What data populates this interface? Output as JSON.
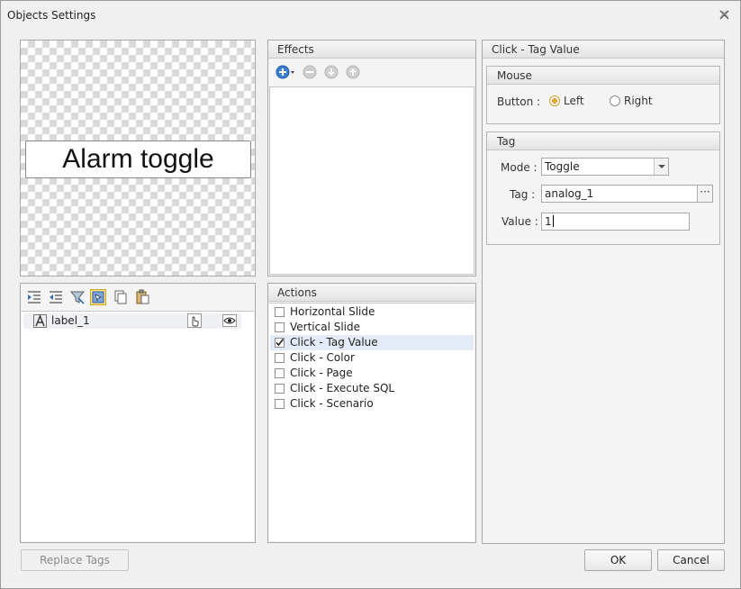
{
  "window": {
    "title": "Objects Settings"
  },
  "preview": {
    "label_text": "Alarm toggle"
  },
  "layers": {
    "toolbar_icons": [
      "indent-icon",
      "outdent-icon",
      "filter-icon",
      "select-icon",
      "copy-icon",
      "paste-icon"
    ],
    "items": [
      {
        "name": "label_1"
      }
    ]
  },
  "effects": {
    "header": "Effects",
    "toolbar_icons": [
      "add-icon",
      "remove-icon",
      "move-down-icon",
      "move-up-icon"
    ]
  },
  "actions": {
    "header": "Actions",
    "items": [
      {
        "label": "Horizontal Slide",
        "checked": false
      },
      {
        "label": "Vertical Slide",
        "checked": false
      },
      {
        "label": "Click - Tag Value",
        "checked": true
      },
      {
        "label": "Click - Color",
        "checked": false
      },
      {
        "label": "Click - Page",
        "checked": false
      },
      {
        "label": "Click - Execute SQL",
        "checked": false
      },
      {
        "label": "Click - Scenario",
        "checked": false
      }
    ]
  },
  "props": {
    "header": "Click - Tag Value",
    "mouse": {
      "header": "Mouse",
      "button_label": "Button :",
      "left_label": "Left",
      "right_label": "Right",
      "selected": "Left"
    },
    "tag": {
      "header": "Tag",
      "mode_label": "Mode :",
      "mode_value": "Toggle",
      "tag_label": "Tag :",
      "tag_value": "analog_1",
      "browse_label": "···",
      "value_label": "Value :",
      "value_value": "1"
    }
  },
  "footer": {
    "replace_tags_label": "Replace Tags",
    "ok_label": "OK",
    "cancel_label": "Cancel"
  },
  "colors": {
    "accent_orange": "#e8a324",
    "selection": "#e3ecf6",
    "add_blue": "#3b7fd4"
  }
}
